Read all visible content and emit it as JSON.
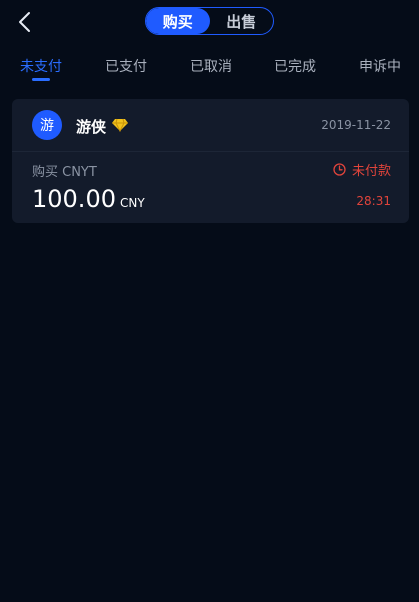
{
  "header": {
    "back_icon": "chevron-left-icon",
    "segments": [
      {
        "label": "购买",
        "active": true
      },
      {
        "label": "出售",
        "active": false
      }
    ],
    "accent_color": "#1f5bff"
  },
  "tabs": [
    {
      "label": "未支付",
      "active": true
    },
    {
      "label": "已支付",
      "active": false
    },
    {
      "label": "已取消",
      "active": false
    },
    {
      "label": "已完成",
      "active": false
    },
    {
      "label": "申诉中",
      "active": false
    }
  ],
  "order": {
    "avatar_text": "游",
    "username": "游侠",
    "badge_icon": "diamond-icon",
    "date": "2019-11-22",
    "type_label": "购买 CNYT",
    "status_icon": "clock-icon",
    "status_label": "未付款",
    "status_color": "#e0443b",
    "amount": "100.00",
    "amount_unit": "CNY",
    "countdown": "28:31"
  }
}
